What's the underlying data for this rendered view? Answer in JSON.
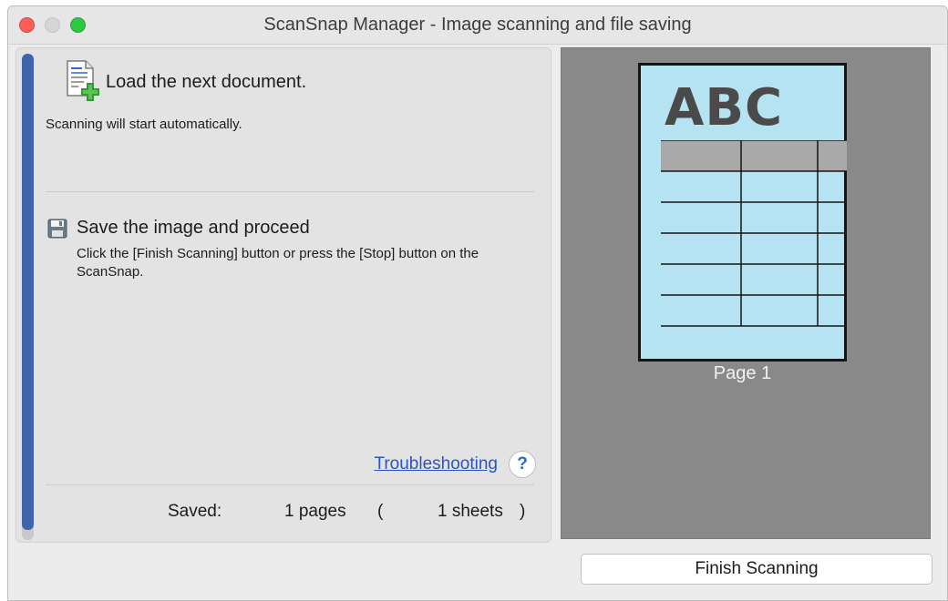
{
  "window": {
    "title": "ScanSnap Manager - Image scanning and file saving"
  },
  "steps": {
    "load": {
      "title": "Load the next document.",
      "description": "Scanning will start automatically.",
      "icon": "document-add-icon"
    },
    "save": {
      "title": "Save the image and proceed",
      "description": "Click the [Finish Scanning] button or press the [Stop] button on the ScanSnap.",
      "icon": "floppy-disk-icon"
    }
  },
  "progress": {
    "fraction": 0.98,
    "color": "#3f64ad"
  },
  "links": {
    "troubleshooting": "Troubleshooting",
    "help": "?"
  },
  "status": {
    "saved_label": "Saved:",
    "pages": "1 pages",
    "paren_open": "(",
    "sheets": "1 sheets",
    "paren_close": ")"
  },
  "preview": {
    "page_heading": "ABC",
    "page_label": "Page 1"
  },
  "buttons": {
    "finish": "Finish Scanning"
  }
}
